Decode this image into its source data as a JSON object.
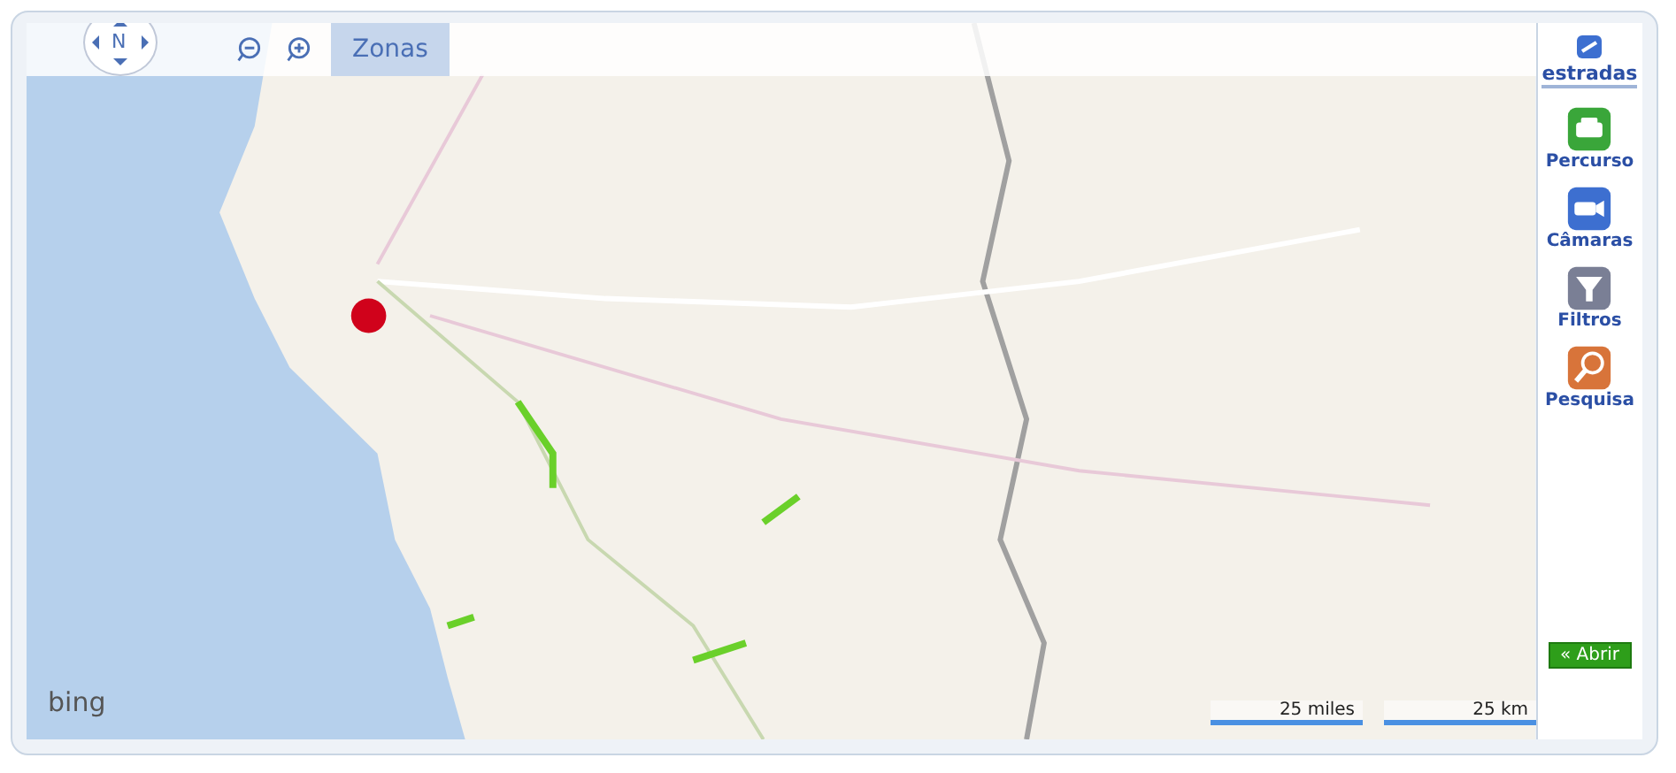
{
  "map_toolbar": {
    "compass": "N",
    "zones_button": "Zonas"
  },
  "map": {
    "logo": "bing",
    "scale": [
      "25 miles",
      "25 km"
    ]
  },
  "sidebar": {
    "logo": "estradas",
    "items": [
      {
        "label": "Percurso",
        "kind": "route"
      },
      {
        "label": "Câmaras",
        "kind": "camera"
      },
      {
        "label": "Filtros",
        "kind": "filter"
      },
      {
        "label": "Pesquisa",
        "kind": "search"
      }
    ],
    "open_button": "« Abrir"
  }
}
